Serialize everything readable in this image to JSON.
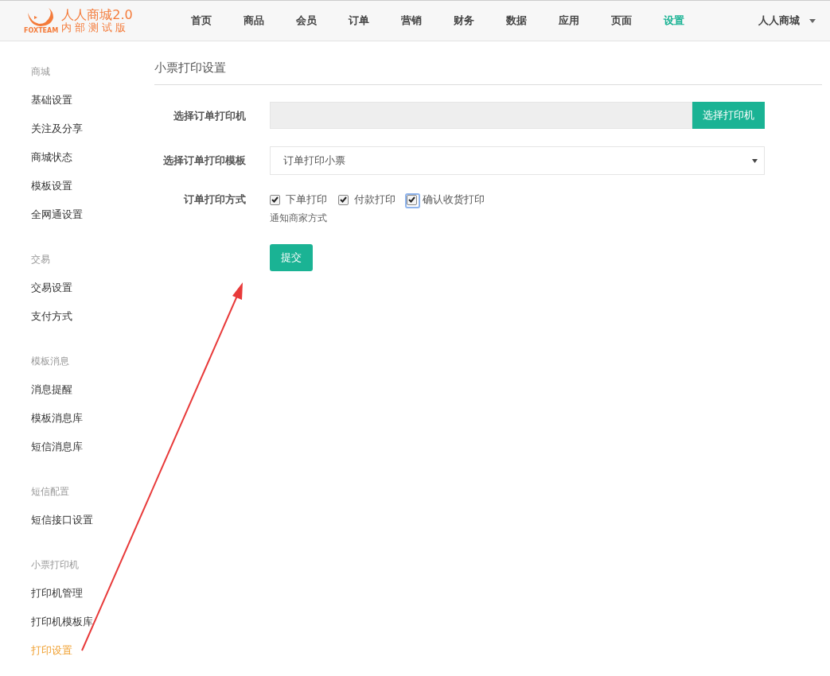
{
  "logo": {
    "brand": "FOXTEAM",
    "title": "人人商城2.0",
    "subtitle": "内部测试版"
  },
  "nav": [
    {
      "label": "首页",
      "selected": false
    },
    {
      "label": "商品",
      "selected": false
    },
    {
      "label": "会员",
      "selected": false
    },
    {
      "label": "订单",
      "selected": false
    },
    {
      "label": "营销",
      "selected": false
    },
    {
      "label": "财务",
      "selected": false
    },
    {
      "label": "数据",
      "selected": false
    },
    {
      "label": "应用",
      "selected": false
    },
    {
      "label": "页面",
      "selected": false
    },
    {
      "label": "设置",
      "selected": true
    }
  ],
  "user_menu": {
    "label": "人人商城"
  },
  "sidebar": [
    {
      "title": "商城",
      "items": [
        {
          "label": "基础设置",
          "selected": false
        },
        {
          "label": "关注及分享",
          "selected": false
        },
        {
          "label": "商城状态",
          "selected": false
        },
        {
          "label": "模板设置",
          "selected": false
        },
        {
          "label": "全网通设置",
          "selected": false
        }
      ]
    },
    {
      "title": "交易",
      "items": [
        {
          "label": "交易设置",
          "selected": false
        },
        {
          "label": "支付方式",
          "selected": false
        }
      ]
    },
    {
      "title": "模板消息",
      "items": [
        {
          "label": "消息提醒",
          "selected": false
        },
        {
          "label": "模板消息库",
          "selected": false
        },
        {
          "label": "短信消息库",
          "selected": false
        }
      ]
    },
    {
      "title": "短信配置",
      "items": [
        {
          "label": "短信接口设置",
          "selected": false
        }
      ]
    },
    {
      "title": "小票打印机",
      "items": [
        {
          "label": "打印机管理",
          "selected": false
        },
        {
          "label": "打印机模板库",
          "selected": false
        },
        {
          "label": "打印设置",
          "selected": true
        }
      ]
    }
  ],
  "page_title": "小票打印设置",
  "form": [
    {
      "kind": "picker",
      "label": "选择订单打印机",
      "button": "选择打印机"
    },
    {
      "kind": "select",
      "label": "选择订单打印模板",
      "value": "订单打印小票"
    },
    {
      "kind": "checks",
      "label": "订单打印方式",
      "options": [
        {
          "label": "下单打印",
          "checked": true,
          "focused": false
        },
        {
          "label": "付款打印",
          "checked": true,
          "focused": false
        },
        {
          "label": "确认收货打印",
          "checked": true,
          "focused": true
        }
      ],
      "help": "通知商家方式"
    }
  ],
  "submit": "提交",
  "annotation": {
    "kind": "arrow"
  }
}
